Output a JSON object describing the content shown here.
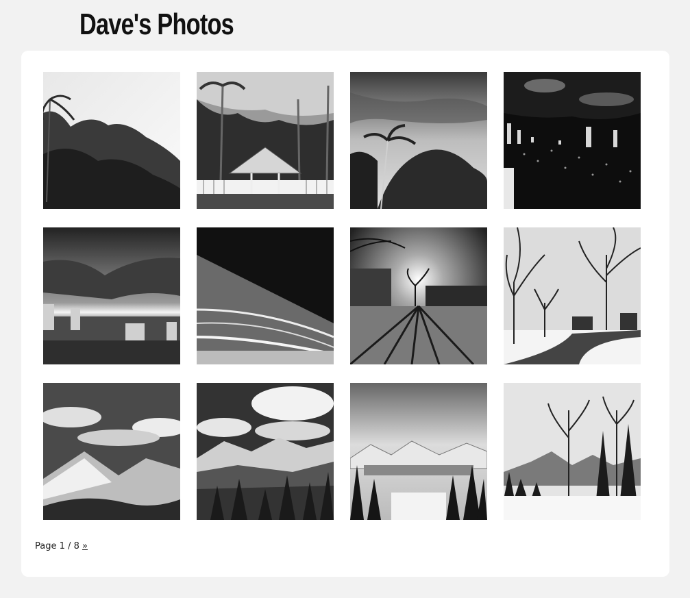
{
  "site": {
    "title": "Dave's Photos"
  },
  "gallery": {
    "photos": [
      {
        "name": "photo-tropical-trees"
      },
      {
        "name": "photo-gazebo-palms"
      },
      {
        "name": "photo-palm-stormy-sky"
      },
      {
        "name": "photo-city-night"
      },
      {
        "name": "photo-city-clouds-sunset"
      },
      {
        "name": "photo-abstract-waves"
      },
      {
        "name": "photo-campus-sun-shadows"
      },
      {
        "name": "photo-winter-park-trees"
      },
      {
        "name": "photo-mountain-valley"
      },
      {
        "name": "photo-mountain-forest-clouds"
      },
      {
        "name": "photo-mountain-lake-forest"
      },
      {
        "name": "photo-snowy-trees-mountain"
      }
    ]
  },
  "pagination": {
    "page_word": "Page",
    "current": "1",
    "separator": "/",
    "total": "8",
    "next_label": "»"
  }
}
